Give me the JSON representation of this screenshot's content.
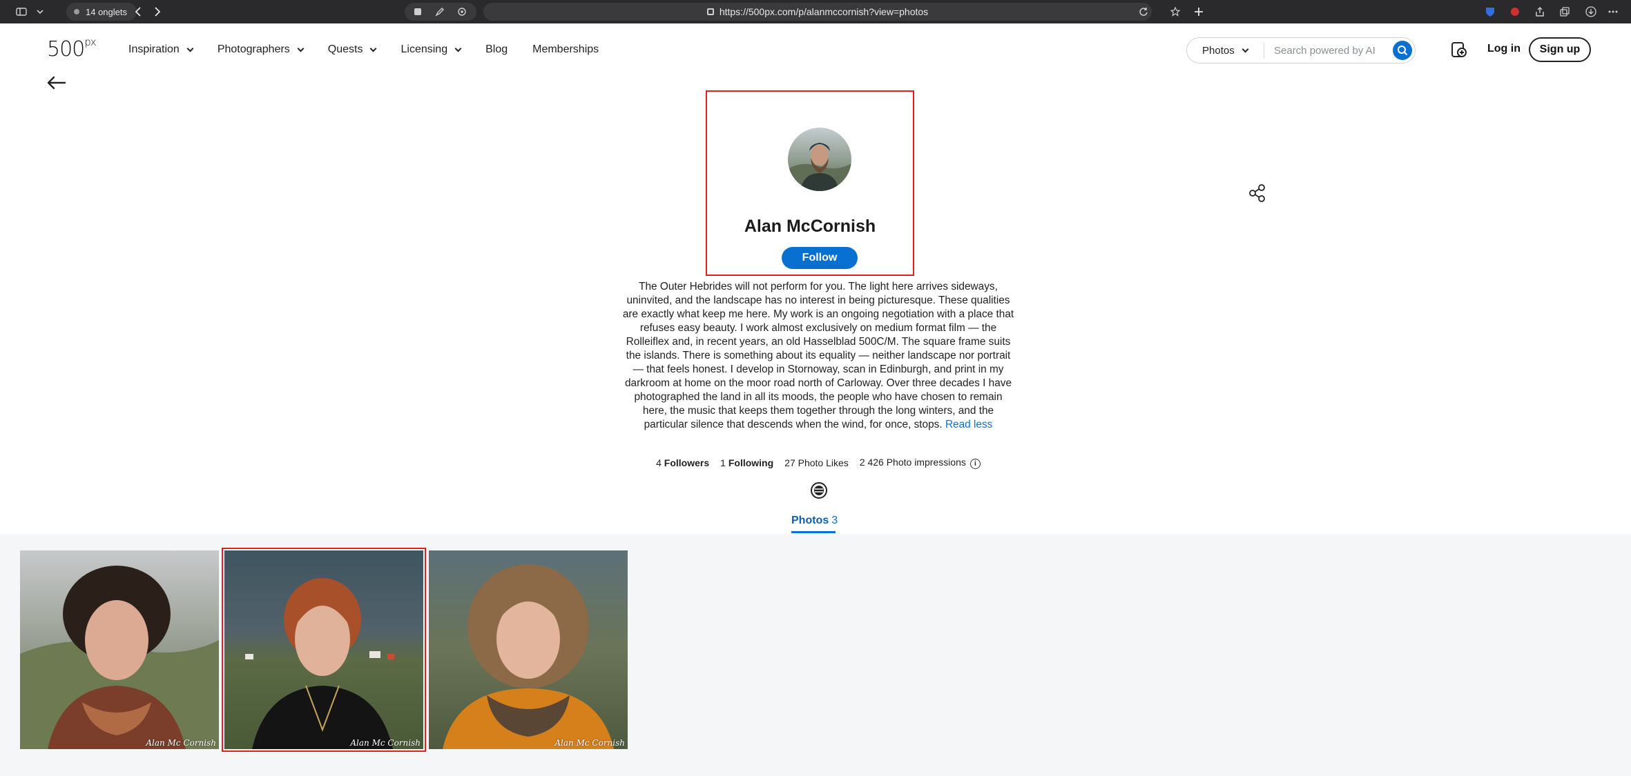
{
  "browser": {
    "tab_count": "14 onglets",
    "url": "https://500px.com/p/alanmccornish?view=photos"
  },
  "header": {
    "logo": "500",
    "logo_sup": "px",
    "nav": [
      {
        "label": "Inspiration",
        "has_dropdown": true
      },
      {
        "label": "Photographers",
        "has_dropdown": true
      },
      {
        "label": "Quests",
        "has_dropdown": true
      },
      {
        "label": "Licensing",
        "has_dropdown": true
      },
      {
        "label": "Blog",
        "has_dropdown": false
      },
      {
        "label": "Memberships",
        "has_dropdown": false
      }
    ],
    "search": {
      "type": "Photos",
      "placeholder": "Search powered by AI"
    },
    "login": "Log in",
    "signup": "Sign up"
  },
  "profile": {
    "name": "Alan McCornish",
    "follow": "Follow",
    "bio": "The Outer Hebrides will not perform for you. The light here arrives sideways, uninvited, and the landscape has no interest in being picturesque. These qualities are exactly what keep me here. My work is an ongoing negotiation with a place that refuses easy beauty. I work almost exclusively on medium format film — the Rolleiflex and, in recent years, an old Hasselblad 500C/M. The square frame suits the islands. There is something about its equality — neither landscape nor portrait — that feels honest. I develop in Stornoway, scan in Edinburgh, and print in my darkroom at home on the moor road north of Carloway. Over three decades I have photographed the land in all its moods, the people who have chosen to remain here, the music that keeps them together through the long winters, and the particular silence that descends when the wind, for once, stops.",
    "read_less": "Read less",
    "stats": {
      "followers_count": "4",
      "followers_label": "Followers",
      "following_count": "1",
      "following_label": "Following",
      "likes": "27 Photo Likes",
      "impressions": "2 426 Photo impressions"
    }
  },
  "tabs": {
    "photos_label": "Photos",
    "photos_count": "3"
  },
  "photos": [
    {
      "watermark": "Alan Mc Cornish",
      "selected": false
    },
    {
      "watermark": "Alan Mc Cornish",
      "selected": true
    },
    {
      "watermark": "Alan Mc Cornish",
      "selected": false
    }
  ],
  "colors": {
    "accent": "#0870d1",
    "highlight": "#e02020"
  }
}
